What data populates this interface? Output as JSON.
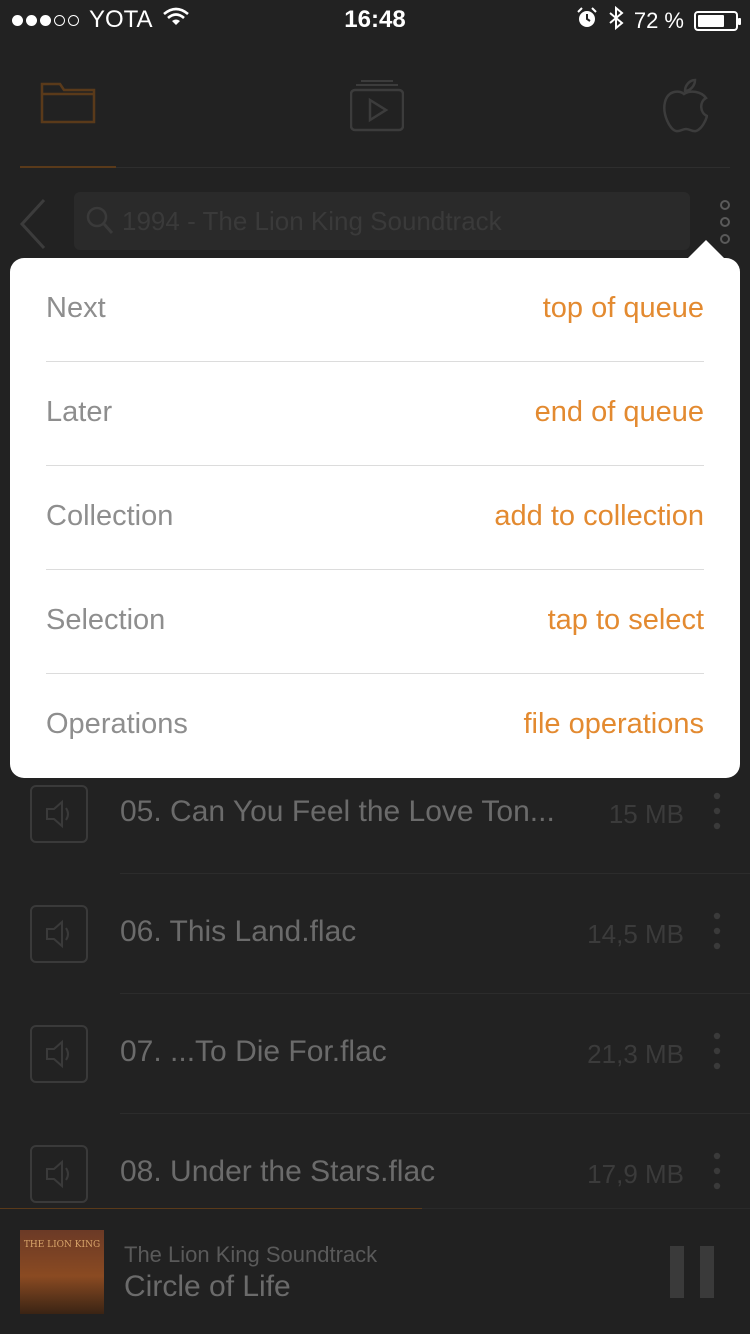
{
  "status_bar": {
    "carrier": "YOTA",
    "signal_filled": 3,
    "signal_total": 5,
    "time": "16:48",
    "battery_text": "72 %",
    "battery_level": 0.72,
    "icons": [
      "wifi-icon",
      "alarm-icon",
      "bluetooth-icon",
      "battery-icon"
    ]
  },
  "tabs": {
    "items": [
      "folder-icon",
      "play-queue-icon",
      "apple-icon"
    ],
    "active": 0,
    "accent": "#5a3a1a"
  },
  "search": {
    "query": "1994 - The Lion King Soundtrack"
  },
  "popover_menu": {
    "items": [
      {
        "label": "Next",
        "action": "top of queue"
      },
      {
        "label": "Later",
        "action": "end of queue"
      },
      {
        "label": "Collection",
        "action": "add to collection"
      },
      {
        "label": "Selection",
        "action": "tap to select"
      },
      {
        "label": "Operations",
        "action": "file operations"
      }
    ],
    "label_color": "#8e8e8e",
    "action_color": "#e38a30"
  },
  "tracks": [
    {
      "name": "05. Can You Feel the Love Ton...",
      "size": "15 MB"
    },
    {
      "name": "06. This Land.flac",
      "size": "14,5 MB"
    },
    {
      "name": "07. ...To Die For.flac",
      "size": "21,3 MB"
    },
    {
      "name": "08. Under the Stars.flac",
      "size": "17,9 MB"
    }
  ],
  "now_playing": {
    "album": "The Lion King Soundtrack",
    "title": "Circle of Life",
    "cover_text": "THE LION KING",
    "state": "playing"
  },
  "colors": {
    "background": "#222222",
    "accent": "#e38a30"
  }
}
